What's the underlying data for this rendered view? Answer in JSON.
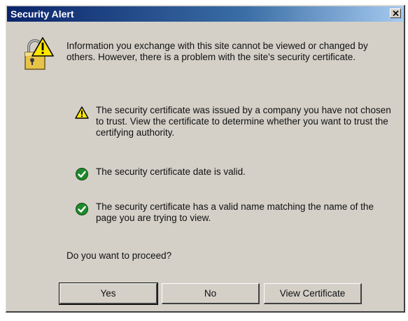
{
  "window": {
    "title": "Security Alert",
    "close_glyph": "x"
  },
  "icons": {
    "main": "lock-warning-icon",
    "warning": "warning-triangle-icon",
    "ok": "green-check-icon"
  },
  "colors": {
    "title_gradient_start": "#0a246a",
    "title_gradient_end": "#a6caf0",
    "dialog_bg": "#d4d0c8",
    "warning_yellow": "#ffe600",
    "ok_green": "#1f8a2b"
  },
  "info": {
    "text": "Information you exchange with this site cannot be viewed or changed by others. However, there is a problem with the site's security certificate."
  },
  "items": [
    {
      "icon": "warning-triangle-icon",
      "text": "The security certificate was issued by a company you have not chosen to trust. View the certificate to determine whether you want to trust the certifying authority."
    },
    {
      "icon": "green-check-icon",
      "text": "The security certificate date is valid."
    },
    {
      "icon": "green-check-icon",
      "text": "The security certificate has a valid name matching the name of the page you are trying to view."
    }
  ],
  "question": "Do you want to proceed?",
  "buttons": {
    "yes": "Yes",
    "no": "No",
    "view_certificate": "View Certificate"
  }
}
